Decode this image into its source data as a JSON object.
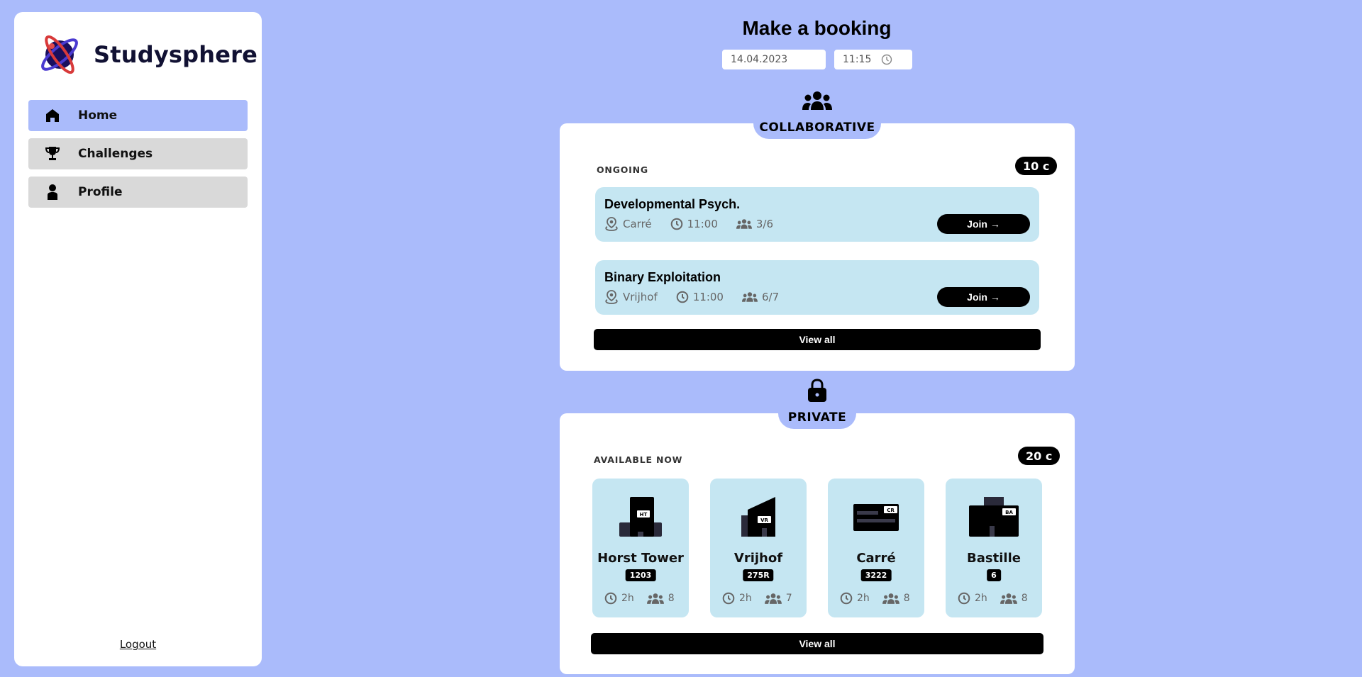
{
  "app": {
    "name": "Studysphere"
  },
  "sidebar": {
    "items": [
      {
        "label": "Home",
        "icon": "home-icon",
        "active": true
      },
      {
        "label": "Challenges",
        "icon": "trophy-icon",
        "active": false
      },
      {
        "label": "Profile",
        "icon": "person-icon",
        "active": false
      }
    ],
    "logout_label": "Logout"
  },
  "main": {
    "title": "Make a booking",
    "date": "14.04.2023",
    "time": "11:15"
  },
  "collaborative": {
    "heading": "COLLABORATIVE",
    "subheading": "ONGOING",
    "cost": "10 c",
    "sessions": [
      {
        "title": "Developmental Psych.",
        "location": "Carré",
        "time": "11:00",
        "participants": "3/6",
        "join_label": "Join →"
      },
      {
        "title": "Binary Exploitation",
        "location": "Vrijhof",
        "time": "11:00",
        "participants": "6/7",
        "join_label": "Join →"
      }
    ],
    "view_all_label": "View all"
  },
  "private": {
    "heading": "PRIVATE",
    "subheading": "AVAILABLE NOW",
    "cost": "20 c",
    "rooms": [
      {
        "name": "Horst Tower",
        "code": "1203",
        "tag": "HT",
        "duration": "2h",
        "capacity": "8"
      },
      {
        "name": "Vrijhof",
        "code": "275R",
        "tag": "VR",
        "duration": "2h",
        "capacity": "7"
      },
      {
        "name": "Carré",
        "code": "3222",
        "tag": "CR",
        "duration": "2h",
        "capacity": "8"
      },
      {
        "name": "Bastille",
        "code": "6",
        "tag": "BA",
        "duration": "2h",
        "capacity": "8"
      }
    ],
    "view_all_label": "View all"
  },
  "colors": {
    "background": "#aabbfb",
    "tile": "#c5e6f2",
    "accent": "#aabbfb",
    "nav_inactive": "#d9d9d9"
  }
}
